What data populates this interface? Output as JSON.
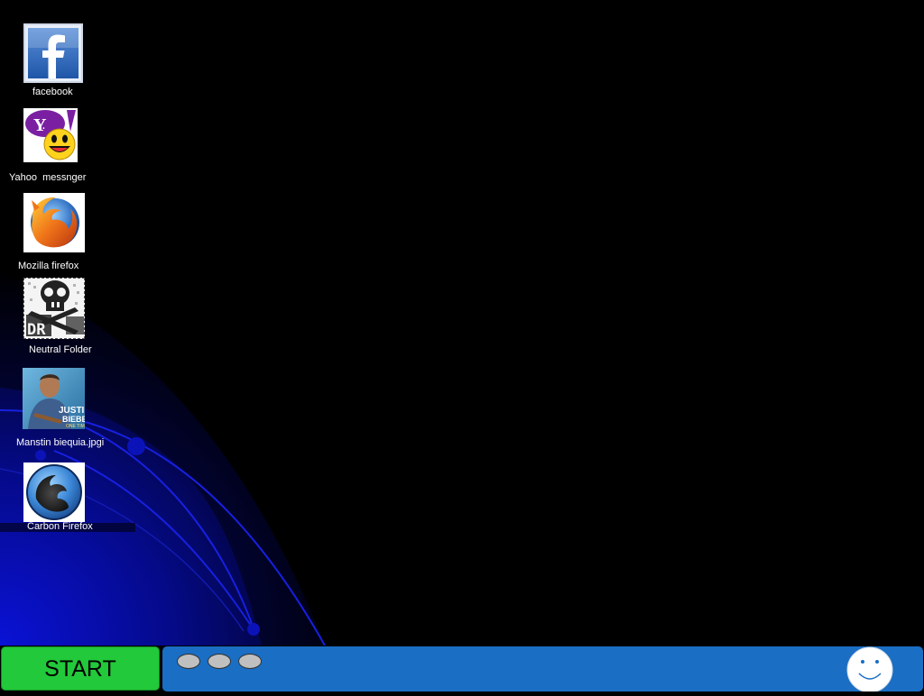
{
  "desktop": {
    "icons": [
      {
        "label": "facebook",
        "icon": "facebook-icon"
      },
      {
        "label": "Yahoo  messnger",
        "icon": "yahoo-messenger-icon"
      },
      {
        "label": "Mozilla firefox",
        "icon": "firefox-icon"
      },
      {
        "label": "Neutral Folder",
        "icon": "neutral-folder-icon"
      },
      {
        "label": "Manstin biequia.jpgi",
        "icon": "image-file-icon"
      },
      {
        "label": "Carbon Firefox",
        "icon": "carbon-firefox-icon"
      }
    ]
  },
  "taskbar": {
    "start_label": "START",
    "quick_launch_count": 3,
    "tray_icon": "smiley-icon"
  },
  "colors": {
    "start_green": "#22c93a",
    "taskbar_blue": "#1a6ec4",
    "desktop_bg": "#000000",
    "wallpaper_blue": "#0a12d6"
  }
}
